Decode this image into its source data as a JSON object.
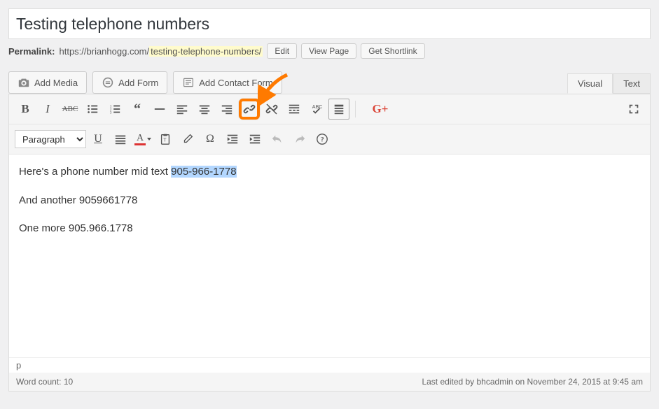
{
  "title": "Testing telephone numbers",
  "permalink": {
    "label": "Permalink:",
    "url_base": "https://brianhogg.com/",
    "slug": "testing-telephone-numbers/",
    "edit": "Edit",
    "view_page": "View Page",
    "get_shortlink": "Get Shortlink"
  },
  "buttons": {
    "add_media": "Add Media",
    "add_form": "Add Form",
    "add_contact_form": "Add Contact Form"
  },
  "tabs": {
    "visual": "Visual",
    "text": "Text"
  },
  "format_select": "Paragraph",
  "social": {
    "gplus": "G+"
  },
  "content": {
    "line1_pre": "Here's a phone number mid text ",
    "line1_highlight": "905-966-1778",
    "line2": "And another 9059661778",
    "line3": "One more 905.966.1778"
  },
  "path": "p",
  "footer": {
    "word_count_label": "Word count: ",
    "word_count": "10",
    "last_edited": "Last edited by bhcadmin on November 24, 2015 at 9:45 am"
  }
}
